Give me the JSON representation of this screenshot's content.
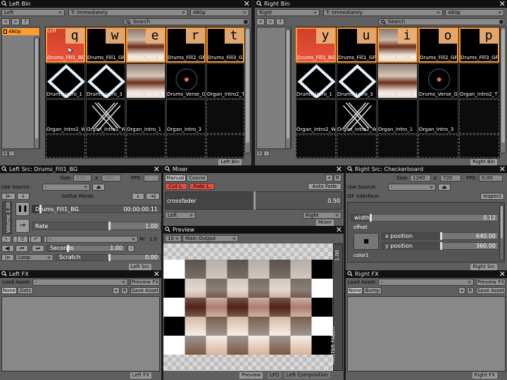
{
  "left_bin": {
    "title": "Left Bin",
    "selector": "Left",
    "trigger": "T: Immediately",
    "res": "480p",
    "nav": [
      "<",
      ">",
      "?"
    ],
    "search": "Search",
    "folder": "480p",
    "page_label": "Left",
    "keys": [
      "q",
      "w",
      "e",
      "r",
      "t"
    ],
    "clips": [
      "Drums_Fill1_BG",
      "Drums_Fill1_GF",
      "Drums_Fill2_BG",
      "Drums_Fill2_GF",
      "Drums_Fill3_GF",
      "Drums_Intro_1",
      "Drums_Intro_3",
      "Drums_Verse_B",
      "Drums_Verse_G",
      "Organ_Intro2_T",
      "Organ_Intro2_W",
      "Organ_Intro2_W",
      "Organ_Intro_1",
      "Organ_Intro_3"
    ],
    "footer": "Left Bin",
    "add": "+",
    "remove": "-"
  },
  "right_bin": {
    "title": "Right Bin",
    "selector": "Right",
    "trigger": "T: Immediately",
    "res": "480p",
    "nav": [
      "<",
      ">",
      "?"
    ],
    "search": "Search",
    "keys": [
      "y",
      "u",
      "i",
      "o",
      "p"
    ],
    "clips": [
      "Drums_Fill1_BG",
      "Drums_Fill1_GF",
      "Drums_Fill2_BG",
      "Drums_Fill2_GF",
      "Drums_Fill3_GF",
      "Drums_Intro_1",
      "Drums_Intro_3",
      "Drums_Verse_B",
      "Drums_Verse_G",
      "Organ_Intro2_T",
      "Organ_Intro2_W",
      "Organ_Intro2_W",
      "Organ_Intro_1",
      "Organ_Intro_3"
    ],
    "footer": "Right Bin",
    "add": "+",
    "remove": "-"
  },
  "left_src": {
    "title": "Left Src: Drums_Fill1_BG",
    "size_label": "Size:",
    "w": "640",
    "x": "x",
    "h": "480",
    "fps_label": "FPS:",
    "fps": "",
    "use_source": "Use Source:",
    "use_source_val": "-",
    "inout": "In/Out Points",
    "volume": "Volume 1.00",
    "clip": "Drums_Fill1_BG",
    "time": "00:00:00.11",
    "rate_label": "Rate",
    "rate_val": "1.00",
    "m_label": "M:",
    "m_val": "1.0",
    "dd2": "-",
    "seconds": "Seconds",
    "seconds_val": "1.00",
    "loop": "Loop",
    "scratch": "Scratch",
    "scratch_val": "0.00",
    "footer": "Left Src"
  },
  "mixer": {
    "title": "Mixer",
    "tabs": [
      "Manual",
      "Cosine"
    ],
    "cut": "Cut L.",
    "fade": "Fade L.",
    "auto_fade": "Auto Fade",
    "crossfader": "crossfader",
    "cf_val": "0.50",
    "crossfade_position": 0.5,
    "left": "Left",
    "right": "Right",
    "footer": "Mixer",
    "plus": "+",
    "r": "R"
  },
  "preview": {
    "title": "Preview",
    "num": "10",
    "output": "Main Output",
    "master": "MASTER FADER",
    "master_val": "1.00",
    "footer_tabs": [
      "Preview",
      "LFO",
      "Left Composition"
    ]
  },
  "right_src": {
    "title": "Right Src: Checkerboard",
    "size_label": "Size:",
    "w": "1280",
    "x": "x",
    "h": "720",
    "fps_label": "FPS:",
    "fps": "0.00",
    "use_source": "Use Source:",
    "use_source_val": "-",
    "isf": "ISF Interface:",
    "inspect": "Inspect",
    "width_label": "width",
    "width_val": "0.12",
    "offset": "offset",
    "xpos": "x position",
    "xpos_val": "640.00",
    "ypos": "y position",
    "ypos_val": "360.00",
    "color1": "color1",
    "footer": "Right Src"
  },
  "left_fx": {
    "title": "Left FX",
    "load_asset": "Load Asset:",
    "asset_val": "-",
    "preview_fx": "Preview FX",
    "tabs": [
      "None",
      "Dots"
    ],
    "save_asset": "Save Asset",
    "footer": "Left FX",
    "plus": "+",
    "r": "R"
  },
  "right_fx": {
    "title": "Right FX",
    "load_asset": "Load Asset:",
    "asset_val": "-",
    "preview_fx": "Preview FX",
    "tabs": [
      "None",
      "Bump"
    ],
    "save_asset": "Save Asset",
    "footer": "Right FX",
    "plus": "+",
    "r": "R"
  }
}
